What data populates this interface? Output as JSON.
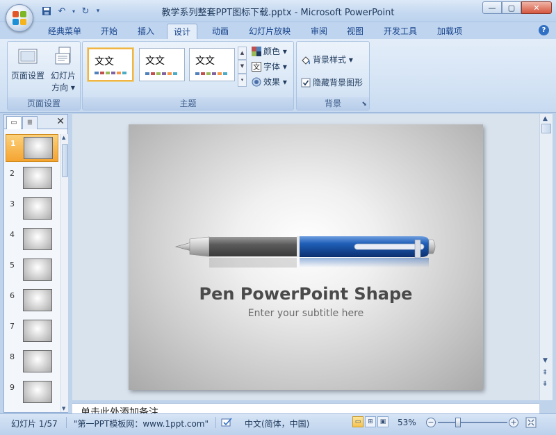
{
  "window": {
    "title": "教学系列整套PPT图标下载.pptx - Microsoft PowerPoint",
    "controls": {
      "minimize": "—",
      "maximize": "▢",
      "close": "✕"
    }
  },
  "quick_access": {
    "save": "save-icon",
    "undo": "undo-icon",
    "redo": "redo-icon",
    "more": "▾"
  },
  "tabs": [
    {
      "label": "经典菜单",
      "active": false
    },
    {
      "label": "开始",
      "active": false
    },
    {
      "label": "插入",
      "active": false
    },
    {
      "label": "设计",
      "active": true
    },
    {
      "label": "动画",
      "active": false
    },
    {
      "label": "幻灯片放映",
      "active": false
    },
    {
      "label": "审阅",
      "active": false
    },
    {
      "label": "视图",
      "active": false
    },
    {
      "label": "开发工具",
      "active": false
    },
    {
      "label": "加载项",
      "active": false
    }
  ],
  "ribbon": {
    "page_setup": {
      "group_label": "页面设置",
      "page_setup_btn": "页面设置",
      "orientation_btn_l1": "幻灯片",
      "orientation_btn_l2": "方向 ▾"
    },
    "themes": {
      "group_label": "主题",
      "items": [
        {
          "label": "文文"
        },
        {
          "label": "文文"
        },
        {
          "label": "文文"
        }
      ],
      "colors": "颜色 ▾",
      "fonts": "字体 ▾",
      "effects": "效果 ▾"
    },
    "background": {
      "group_label": "背景",
      "styles": "背景样式 ▾",
      "hide_graphics": "隐藏背景图形",
      "hide_graphics_checked": true
    }
  },
  "slides_panel": {
    "close": "✕",
    "slides": [
      {
        "num": "1",
        "selected": true
      },
      {
        "num": "2",
        "selected": false
      },
      {
        "num": "3",
        "selected": false
      },
      {
        "num": "4",
        "selected": false
      },
      {
        "num": "5",
        "selected": false
      },
      {
        "num": "6",
        "selected": false
      },
      {
        "num": "7",
        "selected": false
      },
      {
        "num": "8",
        "selected": false
      },
      {
        "num": "9",
        "selected": false
      }
    ]
  },
  "slide": {
    "title": "Pen PowerPoint Shape",
    "subtitle": "Enter your subtitle here"
  },
  "notes": {
    "text": "单击此处添加备注"
  },
  "status": {
    "slide_counter": "幻灯片 1/57",
    "theme_name": "\"第一PPT模板网：www.1ppt.com\"",
    "language": "中文(简体，中国)",
    "zoom": "53%"
  },
  "colors": {
    "accent_orange": "#f5a430",
    "pen_blue": "#1f5fb8",
    "ribbon_blue": "#d2e2f4"
  }
}
